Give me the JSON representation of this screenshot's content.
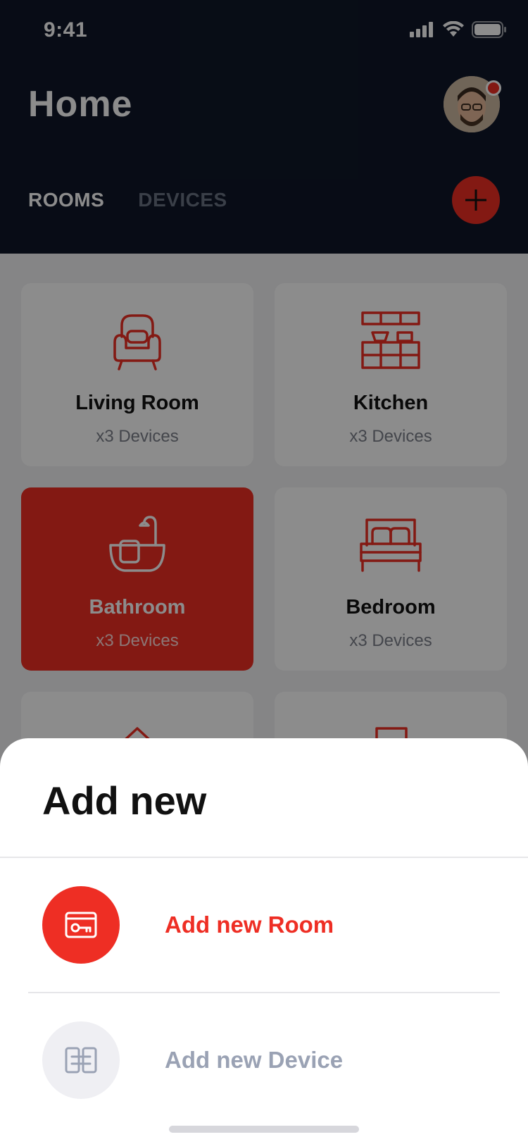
{
  "status_bar": {
    "time": "9:41"
  },
  "header": {
    "title": "Home"
  },
  "tabs": [
    {
      "label": "ROOMS",
      "active": true
    },
    {
      "label": "DEVICES",
      "active": false
    }
  ],
  "rooms": [
    {
      "name": "Living Room",
      "count": "x3 Devices",
      "icon": "armchair-icon",
      "active": false
    },
    {
      "name": "Kitchen",
      "count": "x3 Devices",
      "icon": "kitchen-shelf-icon",
      "active": false
    },
    {
      "name": "Bathroom",
      "count": "x3 Devices",
      "icon": "bathtub-icon",
      "active": true
    },
    {
      "name": "Bedroom",
      "count": "x3 Devices",
      "icon": "bed-icon",
      "active": false
    }
  ],
  "sheet": {
    "title": "Add new",
    "options": [
      {
        "label": "Add new Room",
        "icon": "room-key-card-icon"
      },
      {
        "label": "Add new Device",
        "icon": "device-link-icon"
      }
    ]
  },
  "colors": {
    "header_bg": "#0f1728",
    "accent": "#ee2e24",
    "muted_text": "#9aa2b4"
  }
}
